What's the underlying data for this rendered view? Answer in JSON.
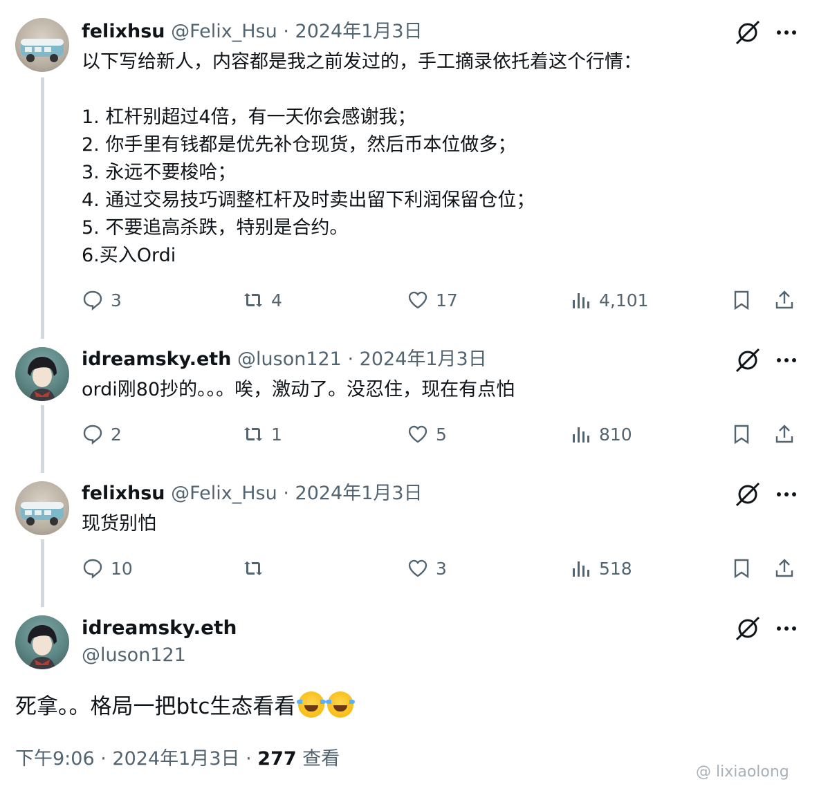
{
  "tweets": [
    {
      "name": "felixhsu",
      "handle": "@Felix_Hsu",
      "separator": "·",
      "date": "2024年1月3日",
      "text": "以下写给新人，内容都是我之前发过的，手工摘录依托着这个行情：\n\n1. 杠杆别超过4倍，有一天你会感谢我；\n2. 你手里有钱都是优先补仓现货，然后币本位做多；\n3. 永远不要梭哈；\n4. 通过交易技巧调整杠杆及时卖出留下利润保留仓位；\n5. 不要追高杀跌，特别是合约。\n6.买入Ordi",
      "replies": "3",
      "reposts": "4",
      "likes": "17",
      "views": "4,101"
    },
    {
      "name": "idreamsky.eth",
      "handle": "@luson121",
      "separator": "·",
      "date": "2024年1月3日",
      "text": "ordi刚80抄的。。。唉，激动了。没忍住，现在有点怕",
      "replies": "2",
      "reposts": "1",
      "likes": "5",
      "views": "810"
    },
    {
      "name": "felixhsu",
      "handle": "@Felix_Hsu",
      "separator": "·",
      "date": "2024年1月3日",
      "text": "现货别怕",
      "replies": "10",
      "reposts": "",
      "likes": "3",
      "views": "518"
    }
  ],
  "main": {
    "name": "idreamsky.eth",
    "handle": "@luson121",
    "text": "死拿。。格局一把btc生态看看",
    "time": "下午9:06",
    "separator": "·",
    "date": "2024年1月3日",
    "views_count": "277",
    "views_label": "查看"
  },
  "watermark": "@ lixiaolong",
  "icons": {
    "grok": "grok-icon",
    "more": "more-icon",
    "reply": "reply-icon",
    "repost": "repost-icon",
    "like": "like-icon",
    "views": "views-icon",
    "bookmark": "bookmark-icon",
    "share": "share-icon"
  },
  "colors": {
    "text": "#0f1419",
    "secondary": "#536471",
    "thread_line": "#cfd9de"
  }
}
